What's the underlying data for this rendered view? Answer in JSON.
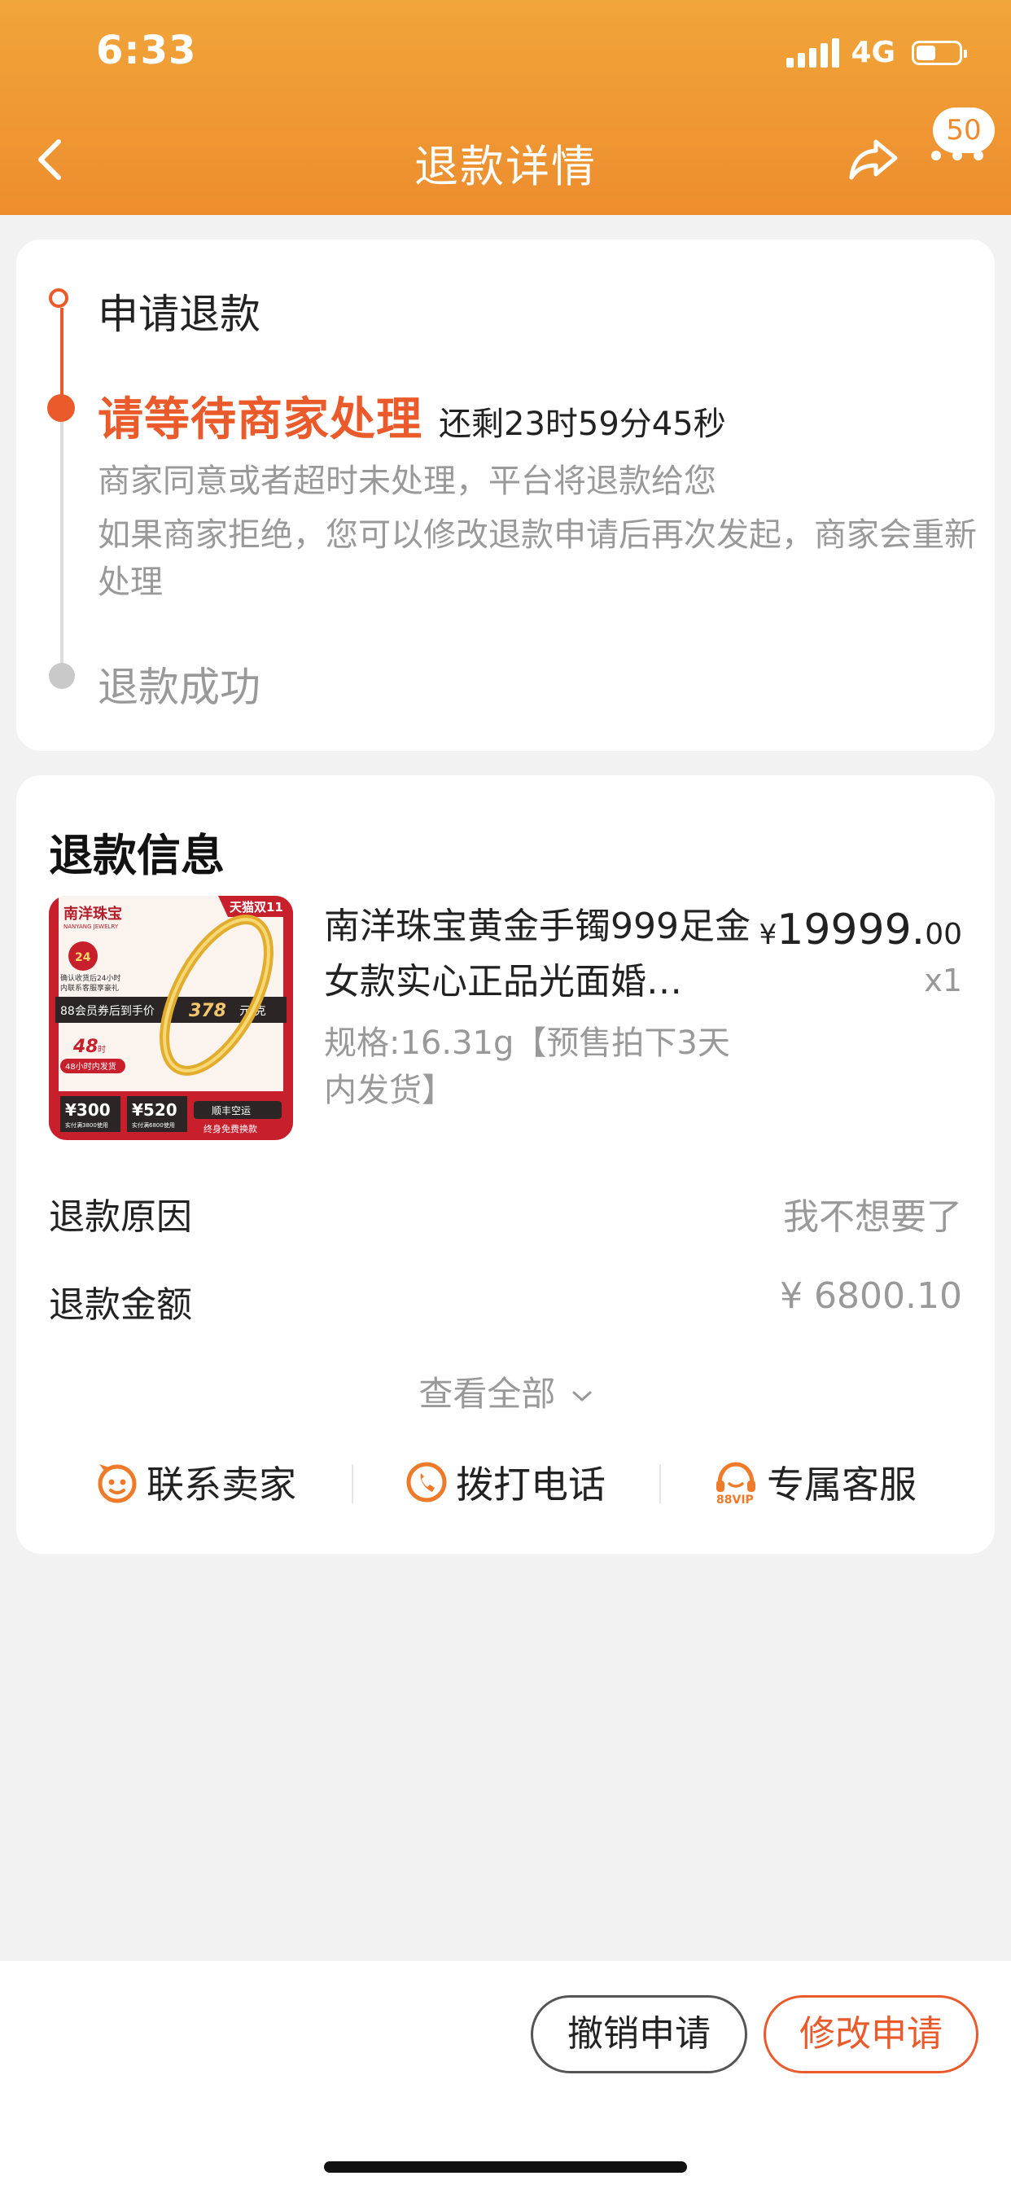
{
  "status_bar": {
    "time": "6:33",
    "network": "4G",
    "battery_level": 0.45
  },
  "nav": {
    "title": "退款详情",
    "badge_count": "50"
  },
  "timeline": {
    "step1_label": "申请退款",
    "step2_title": "请等待商家处理",
    "step2_countdown": "还剩23时59分45秒",
    "step2_desc1": "商家同意或者超时未处理，平台将退款给您",
    "step2_desc2": "如果商家拒绝，您可以修改退款申请后再次发起，商家会重新处理",
    "step3_label": "退款成功"
  },
  "refund_info": {
    "title": "退款信息",
    "product": {
      "name": "南洋珠宝黄金手镯999足金女款实心正品光面婚…",
      "spec": "规格:16.31g【预售拍下3天内发货】",
      "price_symbol": "¥",
      "price_int": "19999.",
      "price_dec": "00",
      "qty": "x1",
      "image": {
        "brand": "南洋珠宝",
        "brand_en": "NANYANG JEWELRY",
        "corner": "天猫双11",
        "badge_24": "24",
        "note1": "确认收货后24小时",
        "note2": "内联系客服享豪礼",
        "member_prefix": "88会员券后到手价",
        "member_price": "378",
        "member_unit": "元/克",
        "tag_48": "48",
        "tag_48_unit": "时",
        "ship_tag": "48小时内发货",
        "coupon1_value": "¥300",
        "coupon1_note": "实付满3800使用",
        "coupon2_value": "¥520",
        "coupon2_note": "实付满6800使用",
        "sf_label": "顺丰空运",
        "sf_note": "终身免费换款"
      }
    },
    "reason_label": "退款原因",
    "reason_value": "我不想要了",
    "amount_label": "退款金额",
    "amount_value": "¥ 6800.10",
    "view_all": "查看全部",
    "actions": {
      "contact_seller": "联系卖家",
      "call_phone": "拨打电话",
      "vip_service": "专属客服",
      "vip_badge": "88VIP"
    }
  },
  "bottom": {
    "cancel_label": "撤销申请",
    "modify_label": "修改申请"
  },
  "colors": {
    "header_start": "#f0a53a",
    "header_end": "#ee8d2e",
    "accent": "#ea5a2a",
    "muted": "#999999"
  }
}
